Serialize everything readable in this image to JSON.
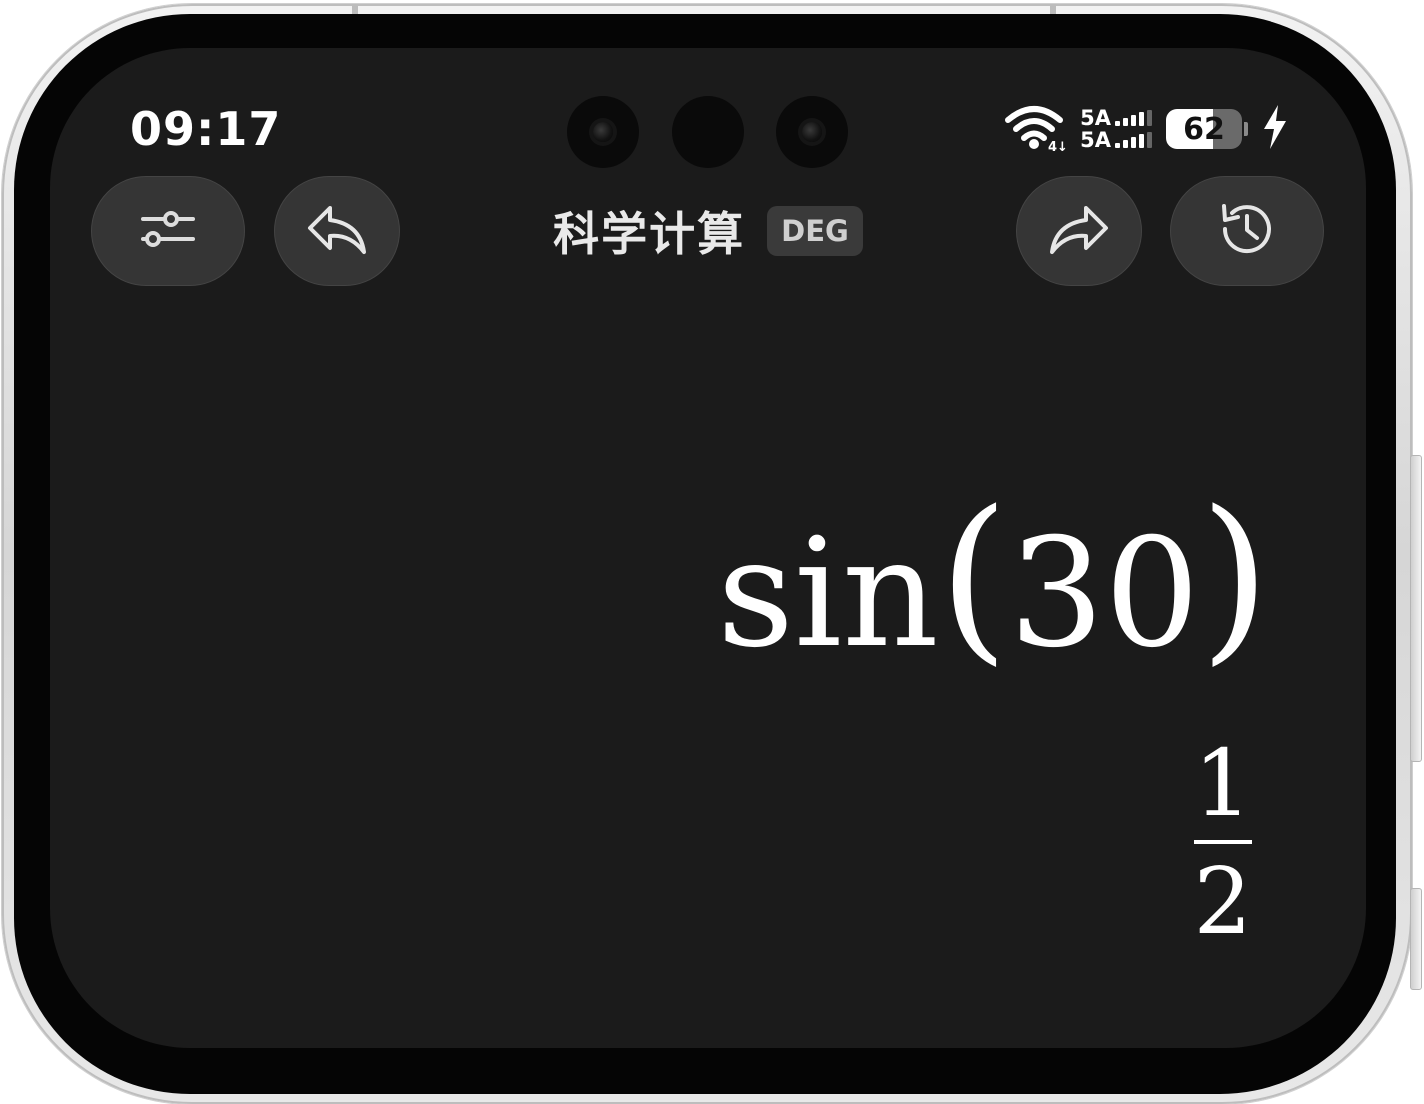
{
  "status": {
    "time": "09:17",
    "net1": "5A",
    "net2": "5A",
    "battery": "62",
    "battery_level": 0.62
  },
  "toolbar": {
    "title": "科学计算",
    "mode": "DEG",
    "icons": {
      "settings": "sliders-icon",
      "undo": "undo-icon",
      "redo": "redo-icon",
      "history": "history-icon"
    }
  },
  "display": {
    "func": "sin",
    "open": "(",
    "arg": "30",
    "close": ")",
    "result_num": "1",
    "result_den": "2"
  },
  "colors": {
    "background": "#1b1b1b",
    "button": "#353535",
    "text": "#ffffff"
  }
}
